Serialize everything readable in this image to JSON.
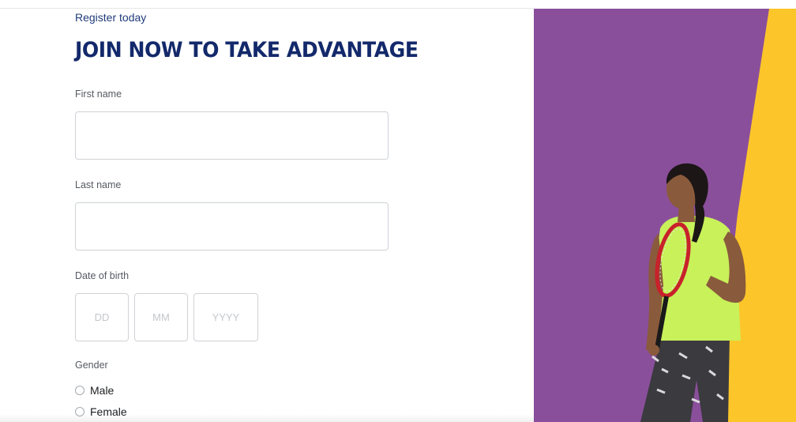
{
  "form": {
    "eyebrow": "Register today",
    "headline": "JOIN NOW TO TAKE ADVANTAGE",
    "first_name": {
      "label": "First name",
      "value": ""
    },
    "last_name": {
      "label": "Last name",
      "value": ""
    },
    "dob": {
      "label": "Date of birth",
      "day_placeholder": "DD",
      "month_placeholder": "MM",
      "year_placeholder": "YYYY"
    },
    "gender": {
      "label": "Gender",
      "options": [
        "Male",
        "Female"
      ]
    }
  },
  "hero": {
    "image": "woman-with-tennis-racket",
    "colors": {
      "purple": "#8a4f9b",
      "yellow": "#fcc62a",
      "top": "#c5f05a"
    }
  },
  "theme": {
    "heading_color": "#13296b",
    "eyebrow_color": "#1f3b7a"
  }
}
